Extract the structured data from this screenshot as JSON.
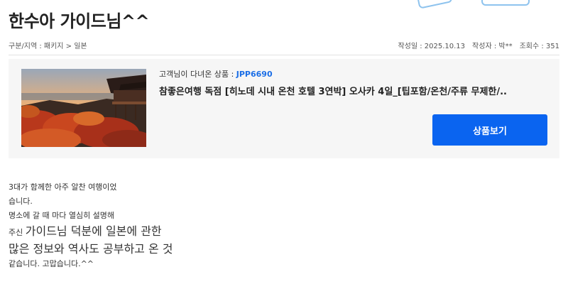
{
  "post": {
    "title": "한수아 가이드님^^",
    "category": "구분/지역 : 패키지 > 일본",
    "date": "작성일 : 2025.10.13",
    "author": "작성자 : 박**",
    "views": "조회수 : 351"
  },
  "product": {
    "visited_label": "고객님이 다녀온 상품 : ",
    "code": "JPP6690",
    "name": "참좋은여행 독점 [히노데 시내 온천 호텔 3연박] 오사카 4일_[팁포함/온천/주류 무제한/..",
    "view_button": "상품보기"
  },
  "review": {
    "line1": "3대가 함께한 아주 알찬 여행이었",
    "line2": "습니다.",
    "line3": "명소에 갈 때 마다  열심히 설명해",
    "line4_prefix": "주신 ",
    "line4_large": "가이드님 덕분에 일본에 관한",
    "line5": "많은 정보와 역사도 공부하고 온 것",
    "line6": "같습니다.  고맙습니다.^^"
  },
  "colors": {
    "accent": "#0a64f0",
    "code": "#1b6ee6",
    "card_bg": "#f6f6f6"
  }
}
